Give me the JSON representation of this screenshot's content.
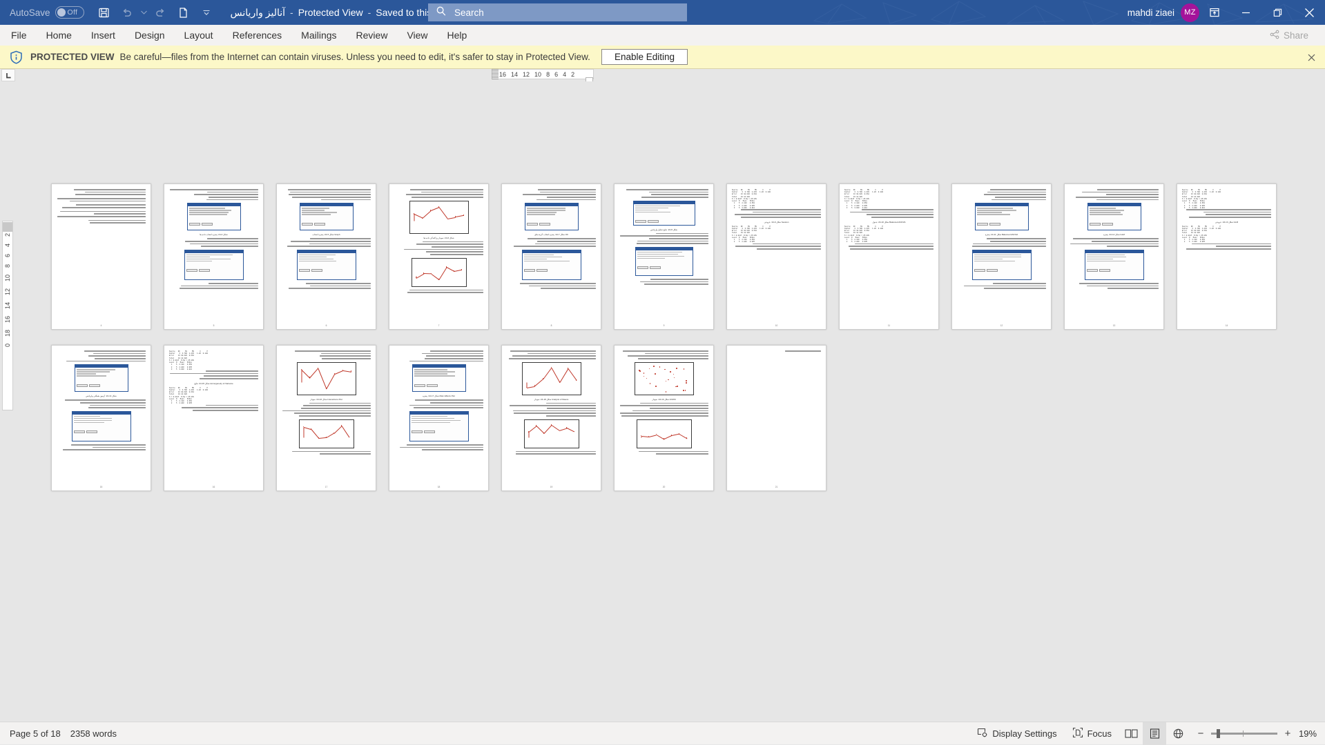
{
  "titlebar": {
    "autosave_label": "AutoSave",
    "autosave_state": "Off",
    "doc_name": "آنالیز واریانس",
    "protected_view_label": "Protected View",
    "saved_state": "Saved to this PC",
    "separator": "-",
    "qat_icons": [
      "save-icon",
      "undo-icon",
      "undo-dropdown-icon",
      "redo-icon",
      "new-page-icon",
      "customize-qat-icon"
    ],
    "user_name": "mahdi ziaei",
    "user_initials": "MZ",
    "window_icons": [
      "ribbon-display-options-icon",
      "minimize-icon",
      "restore-icon",
      "close-icon"
    ],
    "bg_color": "#2b579a",
    "avatar_color": "#a4139a"
  },
  "search": {
    "placeholder": "Search",
    "icon": "search-icon"
  },
  "ribbon": {
    "tabs": [
      {
        "label": "File"
      },
      {
        "label": "Home"
      },
      {
        "label": "Insert"
      },
      {
        "label": "Design"
      },
      {
        "label": "Layout"
      },
      {
        "label": "References"
      },
      {
        "label": "Mailings"
      },
      {
        "label": "Review"
      },
      {
        "label": "View"
      },
      {
        "label": "Help"
      }
    ],
    "share_label": "Share",
    "share_icon": "share-icon"
  },
  "protected_view": {
    "icon": "shield-info-icon",
    "strong": "PROTECTED VIEW",
    "message": "Be careful—files from the Internet can contain viruses. Unless you need to edit, it's safer to stay in Protected View.",
    "enable_button": "Enable Editing",
    "close_icon": "close-icon",
    "bg_color": "#fcf8c8"
  },
  "rulers": {
    "corner_icon": "tab-stop-left-icon",
    "horizontal_ticks": [
      "16",
      "14",
      "12",
      "10",
      "8",
      "6",
      "4",
      "2"
    ],
    "vertical_ticks": [
      "2",
      "4",
      "6",
      "8",
      "10",
      "12",
      "14",
      "16",
      "18",
      "0"
    ]
  },
  "statusbar": {
    "page_indicator": "Page 5 of 18",
    "word_count": "2358 words",
    "display_settings": "Display Settings",
    "display_settings_icon": "display-settings-icon",
    "focus": "Focus",
    "focus_icon": "focus-icon",
    "view_icons": [
      "read-mode-icon",
      "print-layout-icon",
      "web-layout-icon"
    ],
    "active_view": "print-layout-icon",
    "zoom_out_icon": "zoom-minus-icon",
    "zoom_in_icon": "zoom-plus-icon",
    "zoom_level": "19%"
  },
  "document": {
    "zoom_percent": 19,
    "total_pages": 18,
    "current_page": 5,
    "language": "rtl",
    "pages": [
      {
        "num": "4",
        "kind": "text-only",
        "caption": ""
      },
      {
        "num": "5",
        "kind": "text-fig-dialog",
        "caption": "شکل 4-24: پنجره انتخاب داده ها"
      },
      {
        "num": "6",
        "kind": "text-fig-dialog",
        "caption": "شکل 5-24: پنجره انتخاب Graph"
      },
      {
        "num": "7",
        "kind": "text-fig-chart",
        "caption": "شکل 6-24: نمودار پراکندگی داده ها"
      },
      {
        "num": "8",
        "kind": "text-fig-dialog",
        "caption": "شکل 7-24: پنجره انتخاب گزینه های OK"
      },
      {
        "num": "9",
        "kind": "text-fig-table",
        "caption": "شکل 8-24: نتایج تحلیل واریانس"
      },
      {
        "num": "10",
        "kind": "text-mono",
        "caption": "شکل 9-24: خروجی Session"
      },
      {
        "num": "11",
        "kind": "text-mono",
        "caption": "شکل 10-24: جدول Balanced ANOVA"
      },
      {
        "num": "12",
        "kind": "text-fig-dialog",
        "caption": "شکل 11-24: پنجره Balanced ANOVA"
      },
      {
        "num": "13",
        "kind": "text-fig-dialog",
        "caption": "شکل 12-24: پنجره GLM"
      },
      {
        "num": "14",
        "kind": "text-mono",
        "caption": "شکل 13-24: خروجی GLM"
      },
      {
        "num": "15",
        "kind": "text-fig-dialog",
        "caption": "شکل 14-24: آزمون همگنی واریانس"
      },
      {
        "num": "16",
        "kind": "text-mono",
        "caption": "شکل 15-24: نتایج Homogeneity of Variance"
      },
      {
        "num": "17",
        "kind": "text-fig-chart",
        "caption": "شکل 16-24: نمودار Interactions Plot"
      },
      {
        "num": "18",
        "kind": "text-fig-dialog",
        "caption": "شکل 17-24: پنجره Main Effects Plot"
      },
      {
        "num": "19",
        "kind": "text-fig-chart",
        "caption": "شکل 18-24: نمودار Analysis of Means"
      },
      {
        "num": "20",
        "kind": "text-fig-chart",
        "caption": "شکل 19-24: نمودار ANOM"
      },
      {
        "num": "21",
        "kind": "blank",
        "caption": ""
      }
    ]
  }
}
